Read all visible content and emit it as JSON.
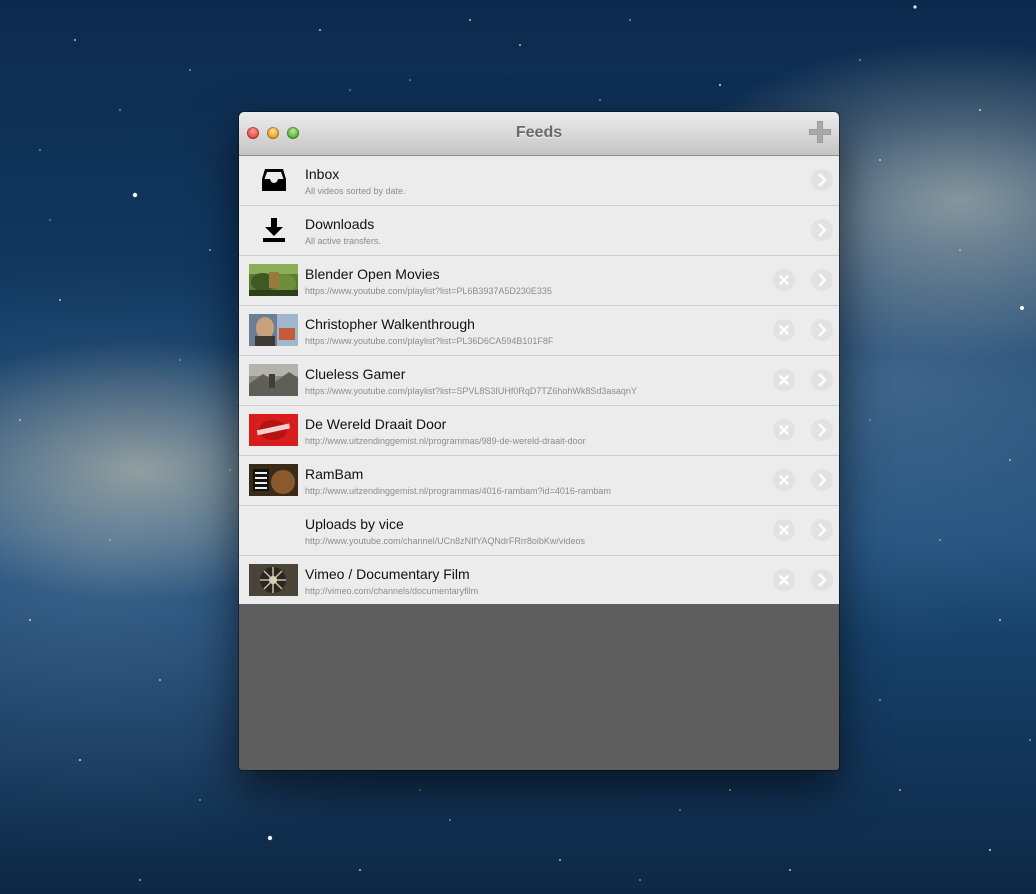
{
  "window": {
    "title": "Feeds",
    "buttons": [
      "close",
      "minimize",
      "zoom"
    ],
    "add_icon": "plus-icon"
  },
  "feeds": [
    {
      "title": "Inbox",
      "subtitle": "All videos sorted by date.",
      "icon": "inbox-tray-icon"
    },
    {
      "title": "Downloads",
      "subtitle": "All active transfers.",
      "icon": "download-arrow-icon"
    },
    {
      "title": "Blender Open Movies",
      "subtitle": "https://www.youtube.com/playlist?list=PL6B3937A5D230E335",
      "icon": "thumbnail"
    },
    {
      "title": "Christopher Walkenthrough",
      "subtitle": "https://www.youtube.com/playlist?list=PL36D6CA594B101F8F",
      "icon": "thumbnail"
    },
    {
      "title": "Clueless Gamer",
      "subtitle": "https://www.youtube.com/playlist?list=SPVL8S3IUHf0RqD7TZ6hohWk8Sd3asaqnY",
      "icon": "thumbnail"
    },
    {
      "title": "De Wereld Draait Door",
      "subtitle": "http://www.uitzendinggemist.nl/programmas/989-de-wereld-draait-door",
      "icon": "thumbnail"
    },
    {
      "title": "RamBam",
      "subtitle": "http://www.uitzendinggemist.nl/programmas/4016-rambam?id=4016-rambam",
      "icon": "thumbnail"
    },
    {
      "title": "Uploads by vice",
      "subtitle": "http://www.youtube.com/channel/UCn8zNIfYAQNdrFRrr8oibKw/videos",
      "icon": "none"
    },
    {
      "title": "Vimeo / Documentary Film",
      "subtitle": "http://vimeo.com/channels/documentaryfilm",
      "icon": "thumbnail"
    }
  ],
  "colors": {
    "row_bg": "#ececec",
    "empty_area": "#5e5e5e",
    "title_text": "#6a6a6a"
  }
}
